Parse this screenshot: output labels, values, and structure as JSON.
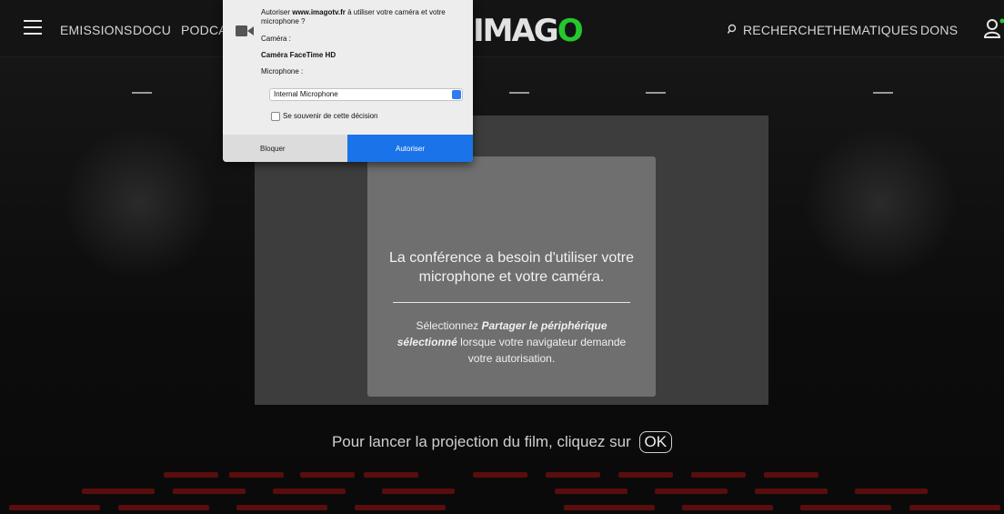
{
  "nav": {
    "items": [
      "EMISSIONS",
      "DOCU",
      "PODCA"
    ],
    "logo_text": "IMAGO",
    "right_items": [
      "RECHERCHE",
      "THEMATIQUES",
      "DONS"
    ],
    "search_icon": "search-icon",
    "user_icon": "user-icon",
    "menu_icon": "hamburger-icon"
  },
  "dialog": {
    "prompt_prefix": "Autoriser ",
    "prompt_site": "www.imagotv.fr",
    "prompt_suffix": " à utiliser votre caméra et votre microphone ?",
    "camera_label": "Caméra :",
    "camera_value": "Caméra FaceTime HD",
    "microphone_label": "Microphone :",
    "microphone_selected": "Internal Microphone",
    "remember_label": "Se souvenir de cette décision",
    "block_label": "Bloquer",
    "allow_label": "Autoriser",
    "icon": "video-camera-icon"
  },
  "card": {
    "title": "La conférence a besoin d'utiliser votre microphone et votre caméra.",
    "body_prefix": "Sélectionnez ",
    "body_bold": "Partager le périphérique sélectionné",
    "body_suffix": " lorsque votre navigateur demande votre autorisation."
  },
  "footer": {
    "prompt": "Pour lancer la projection du film, cliquez sur",
    "ok_label": "OK"
  },
  "colors": {
    "accent_green": "#25c72d",
    "allow_blue": "#1a73e8",
    "seat_red": "#5a0d0d"
  }
}
